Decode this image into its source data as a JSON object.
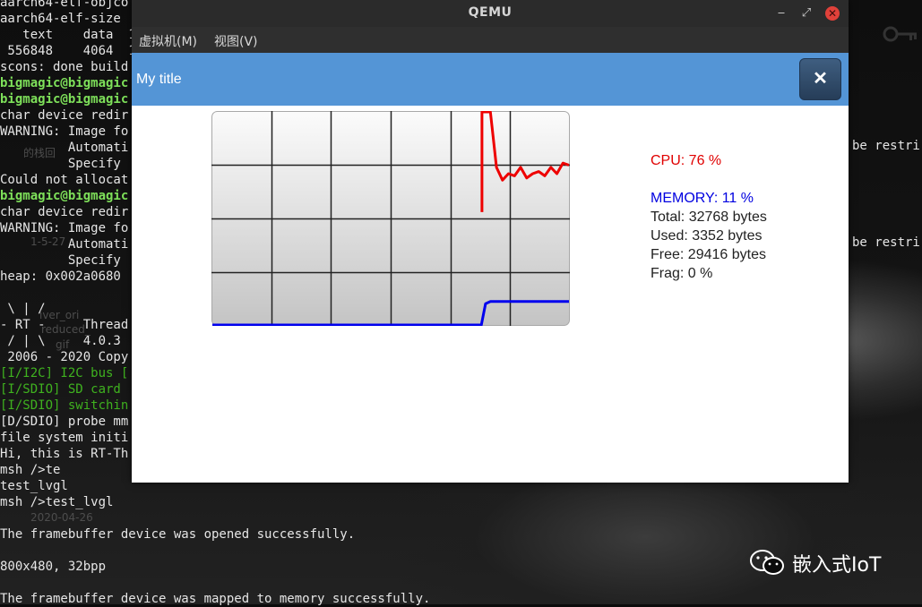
{
  "terminal": {
    "lines": [
      {
        "text": "aarch64-elf-objco",
        "cls": "t-white"
      },
      {
        "text": "aarch64-elf-size",
        "cls": "t-white"
      },
      {
        "text": "   text    data  1",
        "cls": "t-white"
      },
      {
        "text": " 556848    4064  1",
        "cls": "t-white"
      },
      {
        "text": "scons: done build",
        "cls": "t-white"
      },
      {
        "text": "bigmagic@bigmagic",
        "cls": "t-green"
      },
      {
        "text": "bigmagic@bigmagic",
        "cls": "t-green"
      },
      {
        "text": "char device redir",
        "cls": "t-white"
      },
      {
        "text": "WARNING: Image fo",
        "cls": "t-white"
      },
      {
        "text": "         Automati",
        "cls": "t-white"
      },
      {
        "text": "         Specify ",
        "cls": "t-white"
      },
      {
        "text": "Could not allocat",
        "cls": "t-white"
      },
      {
        "text": "bigmagic@bigmagic",
        "cls": "t-green"
      },
      {
        "text": "char device redir",
        "cls": "t-white"
      },
      {
        "text": "WARNING: Image fo",
        "cls": "t-white"
      },
      {
        "text": "         Automati",
        "cls": "t-white"
      },
      {
        "text": "         Specify ",
        "cls": "t-white"
      },
      {
        "text": "heap: 0x002a0680 ",
        "cls": "t-white"
      },
      {
        "text": "",
        "cls": "t-white"
      },
      {
        "text": " \\ | /",
        "cls": "t-white"
      },
      {
        "text": "- RT -     Thread",
        "cls": "t-white"
      },
      {
        "text": " / | \\     4.0.3 ",
        "cls": "t-white"
      },
      {
        "text": " 2006 - 2020 Copy",
        "cls": "t-white"
      },
      {
        "text": "[I/I2C] I2C bus [",
        "cls": "t-darkgreen"
      },
      {
        "text": "[I/SDIO] SD card ",
        "cls": "t-darkgreen"
      },
      {
        "text": "[I/SDIO] switchin",
        "cls": "t-darkgreen"
      },
      {
        "text": "[D/SDIO] probe mm",
        "cls": "t-white"
      },
      {
        "text": "file system initi",
        "cls": "t-white"
      },
      {
        "text": "Hi, this is RT-Th",
        "cls": "t-white"
      },
      {
        "text": "msh />te",
        "cls": "t-white"
      },
      {
        "text": "test_lvgl",
        "cls": "t-white"
      },
      {
        "text": "msh />test_lvgl",
        "cls": "t-white"
      },
      {
        "text": "",
        "cls": "t-white"
      },
      {
        "text": "The framebuffer device was opened successfully.",
        "cls": "t-white"
      },
      {
        "text": "",
        "cls": "t-white"
      },
      {
        "text": "800x480, 32bpp",
        "cls": "t-white"
      },
      {
        "text": "",
        "cls": "t-white"
      },
      {
        "text": "The framebuffer device was mapped to memory successfully.",
        "cls": "t-white"
      }
    ],
    "right_fragment_1": "be restri",
    "right_fragment_2": "be restri"
  },
  "desktop": {
    "ghost_labels": [
      "的栈回",
      "1-5-27",
      "iver_ori",
      "reduced_",
      "gif",
      "2020-04-26"
    ]
  },
  "watermark": {
    "text": "嵌入式IoT",
    "icon": "wechat-icon"
  },
  "window": {
    "title": "QEMU",
    "menu": [
      "虚拟机(M)",
      "视图(V)"
    ],
    "controls": {
      "minimize": "‒",
      "maximize": "⤢",
      "close": "✕"
    }
  },
  "app": {
    "title": "My title",
    "close_label": "✕"
  },
  "monitor": {
    "cpu": "CPU: 76 %",
    "memory": "MEMORY: 11 %",
    "total": "Total: 32768 bytes",
    "used": "Used: 3352 bytes",
    "free": "Free: 29416 bytes",
    "frag": "Frag: 0 %",
    "cpu_color": "#e00000",
    "memory_color": "#0000e0"
  },
  "chart_data": {
    "type": "line",
    "title": "",
    "xlabel": "",
    "ylabel": "",
    "ylim": [
      0,
      100
    ],
    "grid": true,
    "x": [
      0,
      1,
      2,
      3,
      4,
      5,
      6,
      7,
      8,
      9,
      10,
      11,
      12,
      13,
      14,
      15,
      16,
      17,
      18,
      19,
      20,
      21,
      22,
      23,
      24,
      25,
      26,
      27,
      28,
      29,
      30,
      31,
      32,
      33,
      34,
      35,
      36,
      37,
      38,
      39,
      40,
      41,
      42,
      43,
      44,
      45,
      46,
      47,
      48,
      49,
      50,
      51,
      52,
      53,
      54,
      55,
      56,
      57,
      58,
      59
    ],
    "series": [
      {
        "values": [
          null,
          null,
          null,
          null,
          null,
          null,
          null,
          null,
          null,
          null,
          null,
          null,
          null,
          null,
          null,
          null,
          null,
          null,
          null,
          null,
          null,
          null,
          null,
          null,
          null,
          null,
          null,
          null,
          null,
          null,
          null,
          null,
          null,
          null,
          null,
          null,
          null,
          null,
          null,
          null,
          null,
          null,
          null,
          null,
          null,
          null,
          null,
          null,
          null,
          null,
          null,
          null,
          null,
          null,
          null,
          null,
          null,
          null,
          null,
          null
        ],
        "cpu_points": [
          [
            44.6,
            53
          ],
          [
            44.6,
            100
          ],
          [
            46,
            100
          ],
          [
            47,
            74
          ],
          [
            48,
            68
          ],
          [
            49,
            71
          ],
          [
            50,
            70
          ],
          [
            51,
            74
          ],
          [
            52,
            69
          ],
          [
            53,
            71
          ],
          [
            54,
            72
          ],
          [
            55,
            70
          ],
          [
            56,
            74
          ],
          [
            57,
            71
          ],
          [
            58,
            76
          ],
          [
            59,
            75
          ]
        ],
        "color": "#ee0000"
      },
      {
        "mem_points": [
          [
            0,
            0
          ],
          [
            44.5,
            0
          ],
          [
            45.2,
            10
          ],
          [
            46,
            11
          ],
          [
            59,
            11
          ]
        ],
        "color": "#0000ee"
      }
    ]
  }
}
